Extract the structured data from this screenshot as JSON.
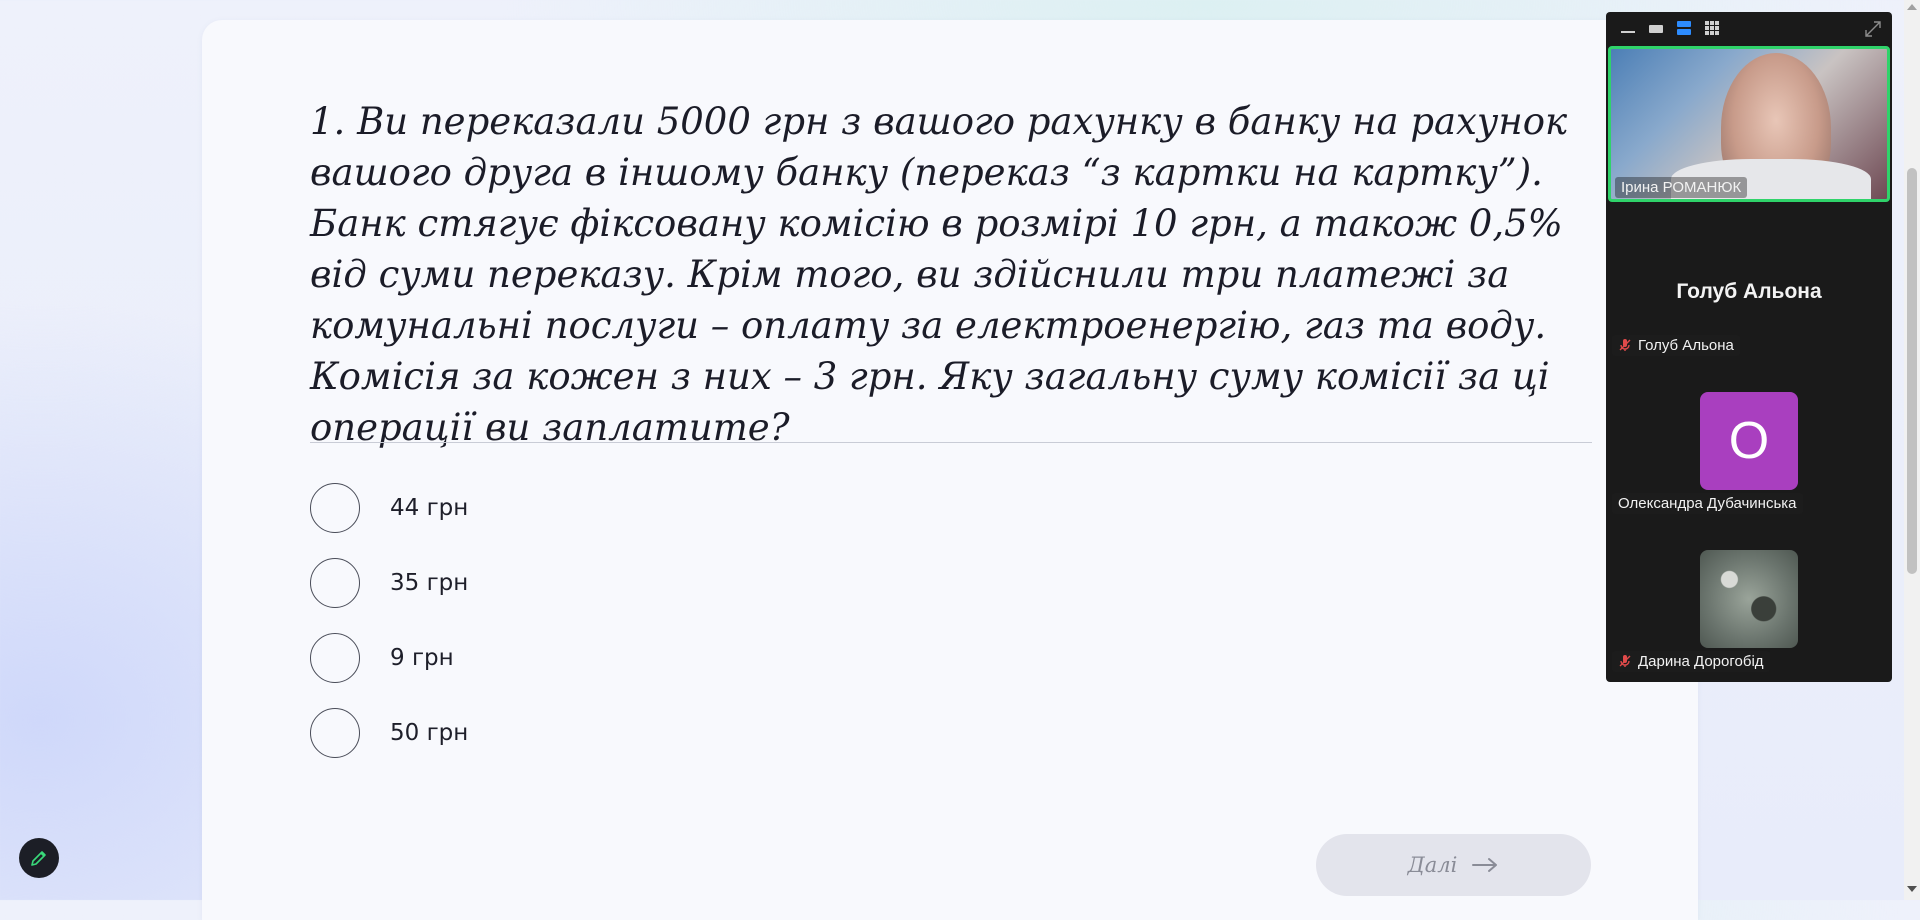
{
  "quiz": {
    "question": "1. Ви переказали 5000 грн з вашого рахунку в банку на рахунок вашого друга в іншому банку (переказ “з картки на картку”). Банк стягує фіксовану комісію в розмірі 10 грн, а також 0,5% від суми переказу. Крім того, ви здійснили три платежі за комунальні послуги – оплату за електроенергію, газ та воду. Комісія за кожен з них – 3 грн. Яку загальну суму комісії за ці операції ви заплатите?",
    "options": [
      "44 грн",
      "35 грн",
      "9 грн",
      "50 грн"
    ],
    "next_label": "Далі"
  },
  "zoom": {
    "active_speaker": "Ірина РОМАНЮК",
    "participants": [
      {
        "display": "Голуб Альона",
        "tag": "Голуб Альона",
        "muted": true
      },
      {
        "avatar_letter": "О",
        "tag": "Олександра Дубачинська",
        "muted": false
      },
      {
        "tag": "Дарина Дорогобід",
        "muted": true
      }
    ],
    "colors": {
      "active_border": "#2fd36a",
      "avatar_bg": "#a93fbf",
      "mute_icon": "#e04a4a"
    }
  },
  "icons": [
    "edit-icon",
    "arrow-right-icon",
    "minimize-icon",
    "speaker-view-icon",
    "gallery-strip-icon",
    "grid-view-icon",
    "fullscreen-icon",
    "mic-muted-icon"
  ]
}
